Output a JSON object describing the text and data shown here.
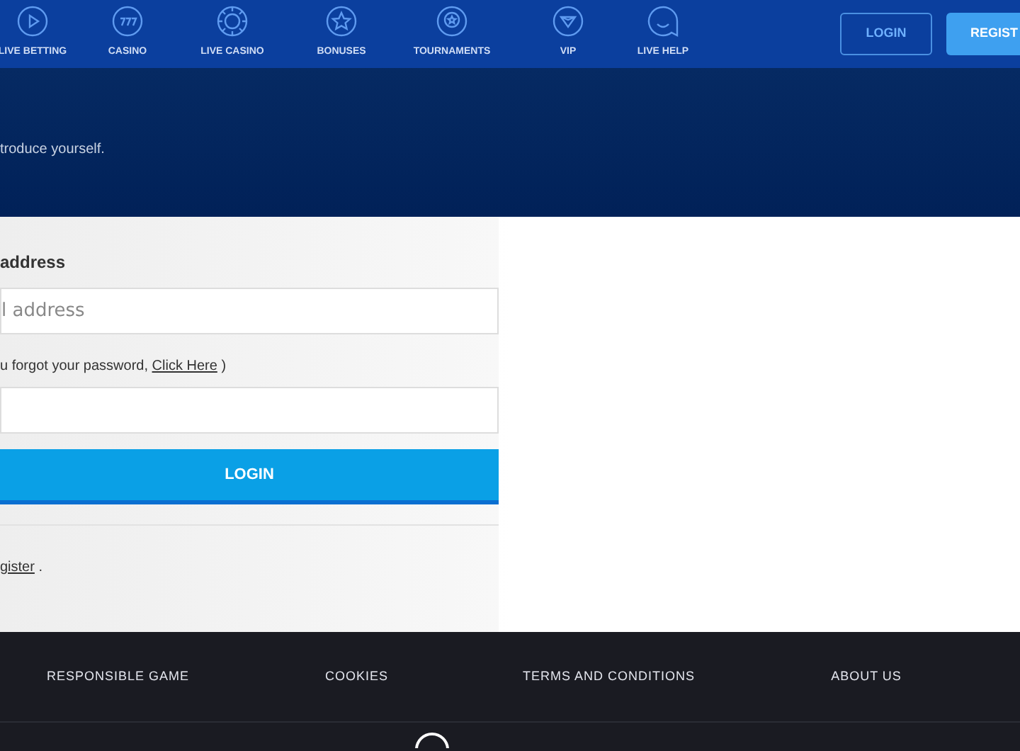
{
  "nav": {
    "items": [
      {
        "label": "LIVE BETTING"
      },
      {
        "label": "CASINO"
      },
      {
        "label": "LIVE CASINO"
      },
      {
        "label": "BONUSES"
      },
      {
        "label": "TOURNAMENTS"
      },
      {
        "label": "VIP"
      },
      {
        "label": "LIVE HELP"
      }
    ],
    "login": "LOGIN",
    "register": "REGIST"
  },
  "hero": {
    "subtitle": "troduce yourself."
  },
  "form": {
    "email_label": "address",
    "email_placeholder": "l address",
    "forgot_text": "u forgot your password,",
    "forgot_link": "Click Here",
    "forgot_close": ")",
    "submit": "LOGIN",
    "register_link": "gister",
    "register_end": "."
  },
  "footer": {
    "links": [
      "RESPONSIBLE GAME",
      "COOKIES",
      "TERMS AND CONDITIONS",
      "ABOUT US"
    ]
  }
}
